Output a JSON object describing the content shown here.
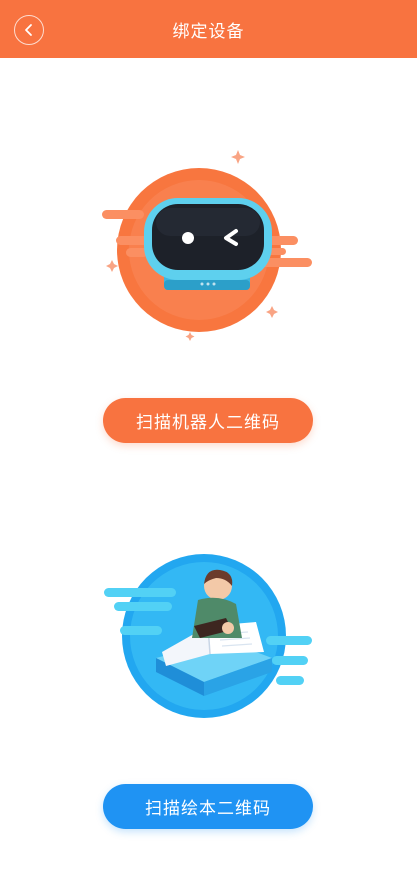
{
  "header": {
    "title": "绑定设备",
    "back_icon": "chevron-left-icon"
  },
  "robot_section": {
    "illustration": "robot-illustration",
    "button_label": "扫描机器人二维码"
  },
  "book_section": {
    "illustration": "picture-book-reader-illustration",
    "button_label": "扫描绘本二维码"
  },
  "colors": {
    "accent_orange": "#f87340",
    "accent_blue": "#1f93f3"
  }
}
